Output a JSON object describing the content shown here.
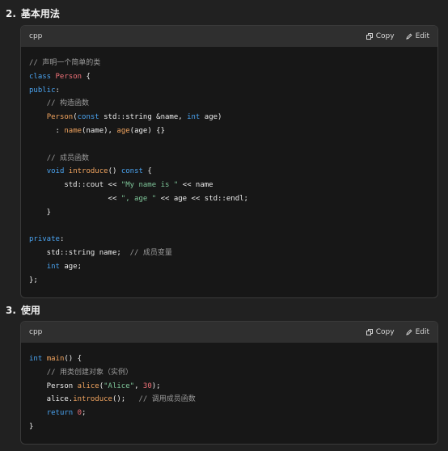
{
  "section2": {
    "number": "2.",
    "title": "基本用法",
    "language": "cpp",
    "copy_label": "Copy",
    "edit_label": "Edit",
    "code_lines": [
      [
        [
          "comment",
          "// 声明一个简单的类"
        ]
      ],
      [
        [
          "keyword",
          "class "
        ],
        [
          "type",
          "Person"
        ],
        [
          "plain",
          " {"
        ]
      ],
      [
        [
          "keyword",
          "public"
        ],
        [
          "plain",
          ":"
        ]
      ],
      [
        [
          "plain",
          "    "
        ],
        [
          "comment",
          "// 构造函数"
        ]
      ],
      [
        [
          "plain",
          "    "
        ],
        [
          "func",
          "Person"
        ],
        [
          "plain",
          "("
        ],
        [
          "keyword",
          "const"
        ],
        [
          "plain",
          " std::string &name, "
        ],
        [
          "keyword",
          "int"
        ],
        [
          "plain",
          " age)"
        ]
      ],
      [
        [
          "plain",
          "      : "
        ],
        [
          "func",
          "name"
        ],
        [
          "plain",
          "(name), "
        ],
        [
          "func",
          "age"
        ],
        [
          "plain",
          "(age) {}"
        ]
      ],
      [
        [
          "plain",
          ""
        ]
      ],
      [
        [
          "plain",
          "    "
        ],
        [
          "comment",
          "// 成员函数"
        ]
      ],
      [
        [
          "plain",
          "    "
        ],
        [
          "keyword",
          "void "
        ],
        [
          "func",
          "introduce"
        ],
        [
          "plain",
          "() "
        ],
        [
          "keyword",
          "const"
        ],
        [
          "plain",
          " {"
        ]
      ],
      [
        [
          "plain",
          "        std::cout << "
        ],
        [
          "string",
          "\"My name is \""
        ],
        [
          "plain",
          " << name"
        ]
      ],
      [
        [
          "plain",
          "                  << "
        ],
        [
          "string",
          "\", age \""
        ],
        [
          "plain",
          " << age << std::endl;"
        ]
      ],
      [
        [
          "plain",
          "    }"
        ]
      ],
      [
        [
          "plain",
          ""
        ]
      ],
      [
        [
          "keyword",
          "private"
        ],
        [
          "plain",
          ":"
        ]
      ],
      [
        [
          "plain",
          "    std::string name;  "
        ],
        [
          "comment",
          "// 成员变量"
        ]
      ],
      [
        [
          "plain",
          "    "
        ],
        [
          "keyword",
          "int"
        ],
        [
          "plain",
          " age;"
        ]
      ],
      [
        [
          "plain",
          "};"
        ]
      ]
    ]
  },
  "section3": {
    "number": "3.",
    "title": "使用",
    "language": "cpp",
    "copy_label": "Copy",
    "edit_label": "Edit",
    "code_lines": [
      [
        [
          "keyword",
          "int "
        ],
        [
          "func",
          "main"
        ],
        [
          "plain",
          "() {"
        ]
      ],
      [
        [
          "plain",
          "    "
        ],
        [
          "comment",
          "// 用类创建对象（实例）"
        ]
      ],
      [
        [
          "plain",
          "    Person "
        ],
        [
          "func",
          "alice"
        ],
        [
          "plain",
          "("
        ],
        [
          "string",
          "\"Alice\""
        ],
        [
          "plain",
          ", "
        ],
        [
          "number",
          "30"
        ],
        [
          "plain",
          ");"
        ]
      ],
      [
        [
          "plain",
          "    alice."
        ],
        [
          "func",
          "introduce"
        ],
        [
          "plain",
          "();   "
        ],
        [
          "comment",
          "// 调用成员函数"
        ]
      ],
      [
        [
          "plain",
          "    "
        ],
        [
          "keyword",
          "return "
        ],
        [
          "number",
          "0"
        ],
        [
          "plain",
          ";"
        ]
      ],
      [
        [
          "plain",
          "}"
        ]
      ]
    ]
  }
}
